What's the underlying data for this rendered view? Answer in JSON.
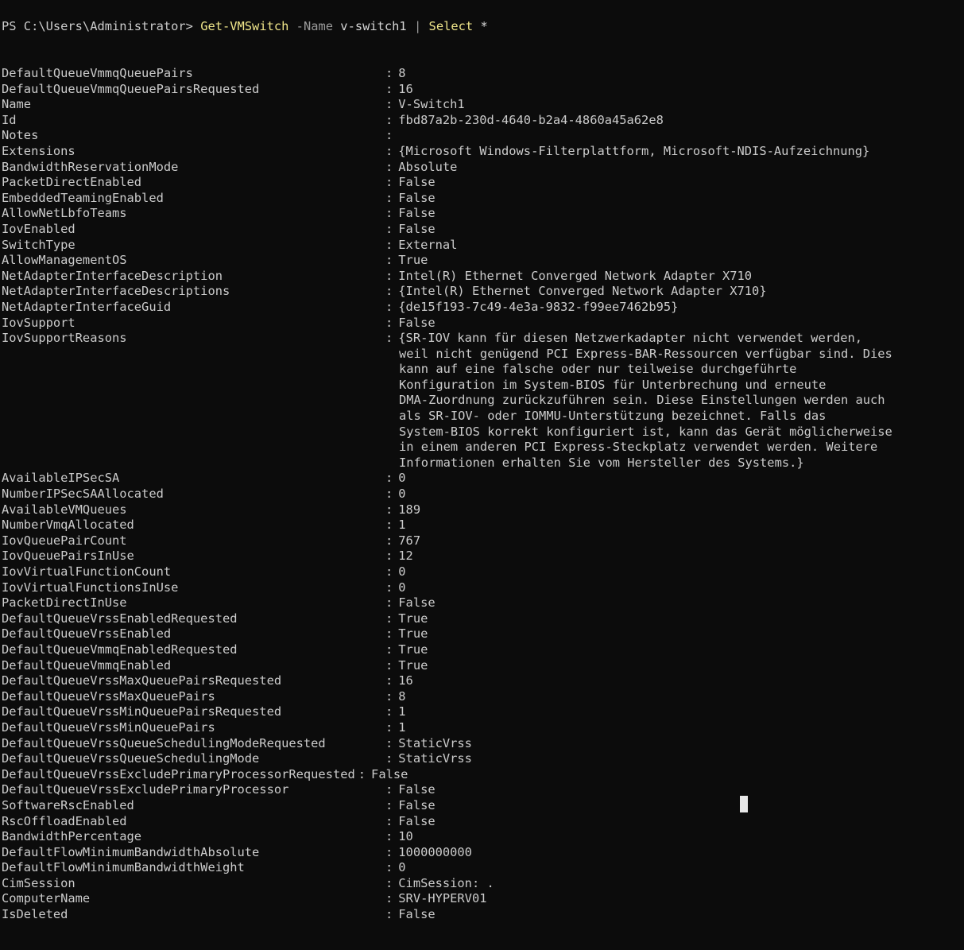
{
  "terminal": {
    "shell": "PowerShell",
    "background_color": "#0c0c0c",
    "foreground_color": "#cccccc",
    "accent_command_color": "#f0e68a",
    "parameter_color": "#9a9a9a",
    "cursor_color": "#e8e8e8"
  },
  "prompt": {
    "prefix": "PS C:\\Users\\Administrator> ",
    "command": "Get-VMSwitch",
    "space1": " ",
    "parameter": "-Name",
    "space2": " ",
    "parameter_value": "v-switch1",
    "space3": " ",
    "pipe": "|",
    "space4": " ",
    "cmdlet2": "Select",
    "space5": " ",
    "wildcard": "*"
  },
  "properties": [
    {
      "name": "DefaultQueueVmmqQueuePairs",
      "value": "8"
    },
    {
      "name": "DefaultQueueVmmqQueuePairsRequested",
      "value": "16"
    },
    {
      "name": "Name",
      "value": "V-Switch1"
    },
    {
      "name": "Id",
      "value": "fbd87a2b-230d-4640-b2a4-4860a45a62e8"
    },
    {
      "name": "Notes",
      "value": ""
    },
    {
      "name": "Extensions",
      "value": "{Microsoft Windows-Filterplattform, Microsoft-NDIS-Aufzeichnung}"
    },
    {
      "name": "BandwidthReservationMode",
      "value": "Absolute"
    },
    {
      "name": "PacketDirectEnabled",
      "value": "False"
    },
    {
      "name": "EmbeddedTeamingEnabled",
      "value": "False"
    },
    {
      "name": "AllowNetLbfoTeams",
      "value": "False"
    },
    {
      "name": "IovEnabled",
      "value": "False"
    },
    {
      "name": "SwitchType",
      "value": "External"
    },
    {
      "name": "AllowManagementOS",
      "value": "True"
    },
    {
      "name": "NetAdapterInterfaceDescription",
      "value": "Intel(R) Ethernet Converged Network Adapter X710"
    },
    {
      "name": "NetAdapterInterfaceDescriptions",
      "value": "{Intel(R) Ethernet Converged Network Adapter X710}"
    },
    {
      "name": "NetAdapterInterfaceGuid",
      "value": "{de15f193-7c49-4e3a-9832-f99ee7462b95}"
    },
    {
      "name": "IovSupport",
      "value": "False"
    },
    {
      "name": "IovSupportReasons",
      "value": "{SR-IOV kann für diesen Netzwerkadapter nicht verwendet werden,",
      "continuation": [
        "weil nicht genügend PCI Express-BAR-Ressourcen verfügbar sind. Dies",
        "kann auf eine falsche oder nur teilweise durchgeführte",
        "Konfiguration im System-BIOS für Unterbrechung und erneute",
        "DMA-Zuordnung zurückzuführen sein. Diese Einstellungen werden auch",
        "als SR-IOV- oder IOMMU-Unterstützung bezeichnet. Falls das",
        "System-BIOS korrekt konfiguriert ist, kann das Gerät möglicherweise",
        "in einem anderen PCI Express-Steckplatz verwendet werden. Weitere",
        "Informationen erhalten Sie vom Hersteller des Systems.}"
      ]
    },
    {
      "name": "AvailableIPSecSA",
      "value": "0"
    },
    {
      "name": "NumberIPSecSAAllocated",
      "value": "0"
    },
    {
      "name": "AvailableVMQueues",
      "value": "189"
    },
    {
      "name": "NumberVmqAllocated",
      "value": "1"
    },
    {
      "name": "IovQueuePairCount",
      "value": "767"
    },
    {
      "name": "IovQueuePairsInUse",
      "value": "12"
    },
    {
      "name": "IovVirtualFunctionCount",
      "value": "0"
    },
    {
      "name": "IovVirtualFunctionsInUse",
      "value": "0"
    },
    {
      "name": "PacketDirectInUse",
      "value": "False"
    },
    {
      "name": "DefaultQueueVrssEnabledRequested",
      "value": "True"
    },
    {
      "name": "DefaultQueueVrssEnabled",
      "value": "True"
    },
    {
      "name": "DefaultQueueVmmqEnabledRequested",
      "value": "True"
    },
    {
      "name": "DefaultQueueVmmqEnabled",
      "value": "True"
    },
    {
      "name": "DefaultQueueVrssMaxQueuePairsRequested",
      "value": "16"
    },
    {
      "name": "DefaultQueueVrssMaxQueuePairs",
      "value": "8"
    },
    {
      "name": "DefaultQueueVrssMinQueuePairsRequested",
      "value": "1"
    },
    {
      "name": "DefaultQueueVrssMinQueuePairs",
      "value": "1"
    },
    {
      "name": "DefaultQueueVrssQueueSchedulingModeRequested",
      "value": "StaticVrss"
    },
    {
      "name": "DefaultQueueVrssQueueSchedulingMode",
      "value": "StaticVrss"
    },
    {
      "name": "DefaultQueueVrssExcludePrimaryProcessorRequested",
      "value": "False",
      "wide": true
    },
    {
      "name": "DefaultQueueVrssExcludePrimaryProcessor",
      "value": "False"
    },
    {
      "name": "SoftwareRscEnabled",
      "value": "False"
    },
    {
      "name": "RscOffloadEnabled",
      "value": "False"
    },
    {
      "name": "BandwidthPercentage",
      "value": "10"
    },
    {
      "name": "DefaultFlowMinimumBandwidthAbsolute",
      "value": "1000000000"
    },
    {
      "name": "DefaultFlowMinimumBandwidthWeight",
      "value": "0"
    },
    {
      "name": "CimSession",
      "value": "CimSession: ."
    },
    {
      "name": "ComputerName",
      "value": "SRV-HYPERV01"
    },
    {
      "name": "IsDeleted",
      "value": "False"
    }
  ]
}
